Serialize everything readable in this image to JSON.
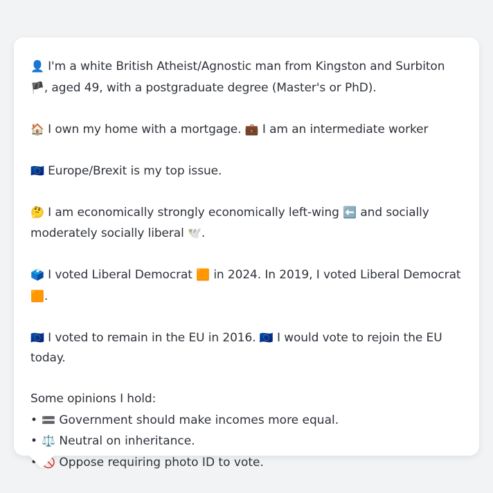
{
  "profile": {
    "identity": {
      "icon": "👤",
      "text1": "I'm a white British Atheist/Agnostic man from Kingston and Surbiton",
      "flag": "🏴",
      "text2": ", aged 49, with a postgraduate degree (Master's or PhD)."
    },
    "home": {
      "home_icon": "🏠",
      "home_text": "I own my home with a mortgage.",
      "work_icon": "💼",
      "work_text": "I am an intermediate worker"
    },
    "issue": {
      "icon": "🇪🇺",
      "text": "Europe/Brexit is my top issue."
    },
    "ideology": {
      "icon": "🤔",
      "text1": "I am economically strongly economically left-wing",
      "left_icon": "⬅️",
      "text2": "and socially moderately socially liberal",
      "dove_icon": "🕊️",
      "end": "."
    },
    "votes": {
      "icon": "🗳️",
      "text1": "I voted Liberal Democrat",
      "party_icon_1": "🟧",
      "text2": "in 2024. In 2019, I voted Liberal Democrat",
      "party_icon_2": "🟧",
      "end": "."
    },
    "eu": {
      "icon1": "🇪🇺",
      "text1": "I voted to remain in the EU in 2016.",
      "icon2": "🇪🇺",
      "text2": "I would vote to rejoin the EU today."
    },
    "opinions": {
      "heading": "Some opinions I hold:",
      "bullet": "•",
      "items": [
        {
          "icon": "🟰",
          "text": "Government should make incomes more equal."
        },
        {
          "icon": "⚖️",
          "text": "Neutral on inheritance."
        },
        {
          "icon": "🚫",
          "text": "Oppose requiring photo ID to vote."
        }
      ]
    }
  },
  "colors": {
    "background": "#f1f3f5",
    "card": "#ffffff",
    "text": "#2d3138"
  }
}
